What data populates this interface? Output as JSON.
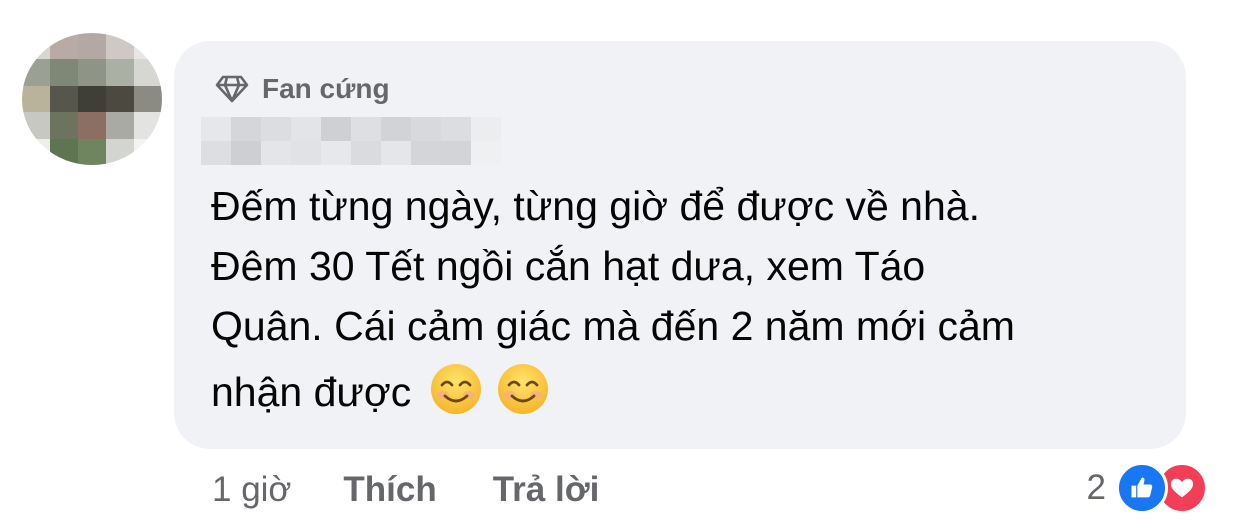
{
  "badge": {
    "label": "Fan cứng",
    "icon": "diamond-icon"
  },
  "comment": {
    "lines": [
      "Đếm từng ngày, từng giờ để được về nhà.",
      "Đêm 30 Tết ngồi cắn hạt dưa, xem Táo",
      "Quân. Cái cảm giác mà đến 2 năm mới cảm",
      "nhận được"
    ],
    "emojis": [
      "smiling-face-icon",
      "smiling-face-icon"
    ]
  },
  "meta": {
    "time": "1 giờ",
    "like_label": "Thích",
    "reply_label": "Trả lời"
  },
  "reactions": {
    "count": "2",
    "types": [
      "like-icon",
      "love-icon"
    ]
  },
  "colors": {
    "bubble": "#f0f2f5",
    "secondary_text": "#65676b",
    "like_blue": "#1877f2",
    "love_red": "#f33e58"
  }
}
